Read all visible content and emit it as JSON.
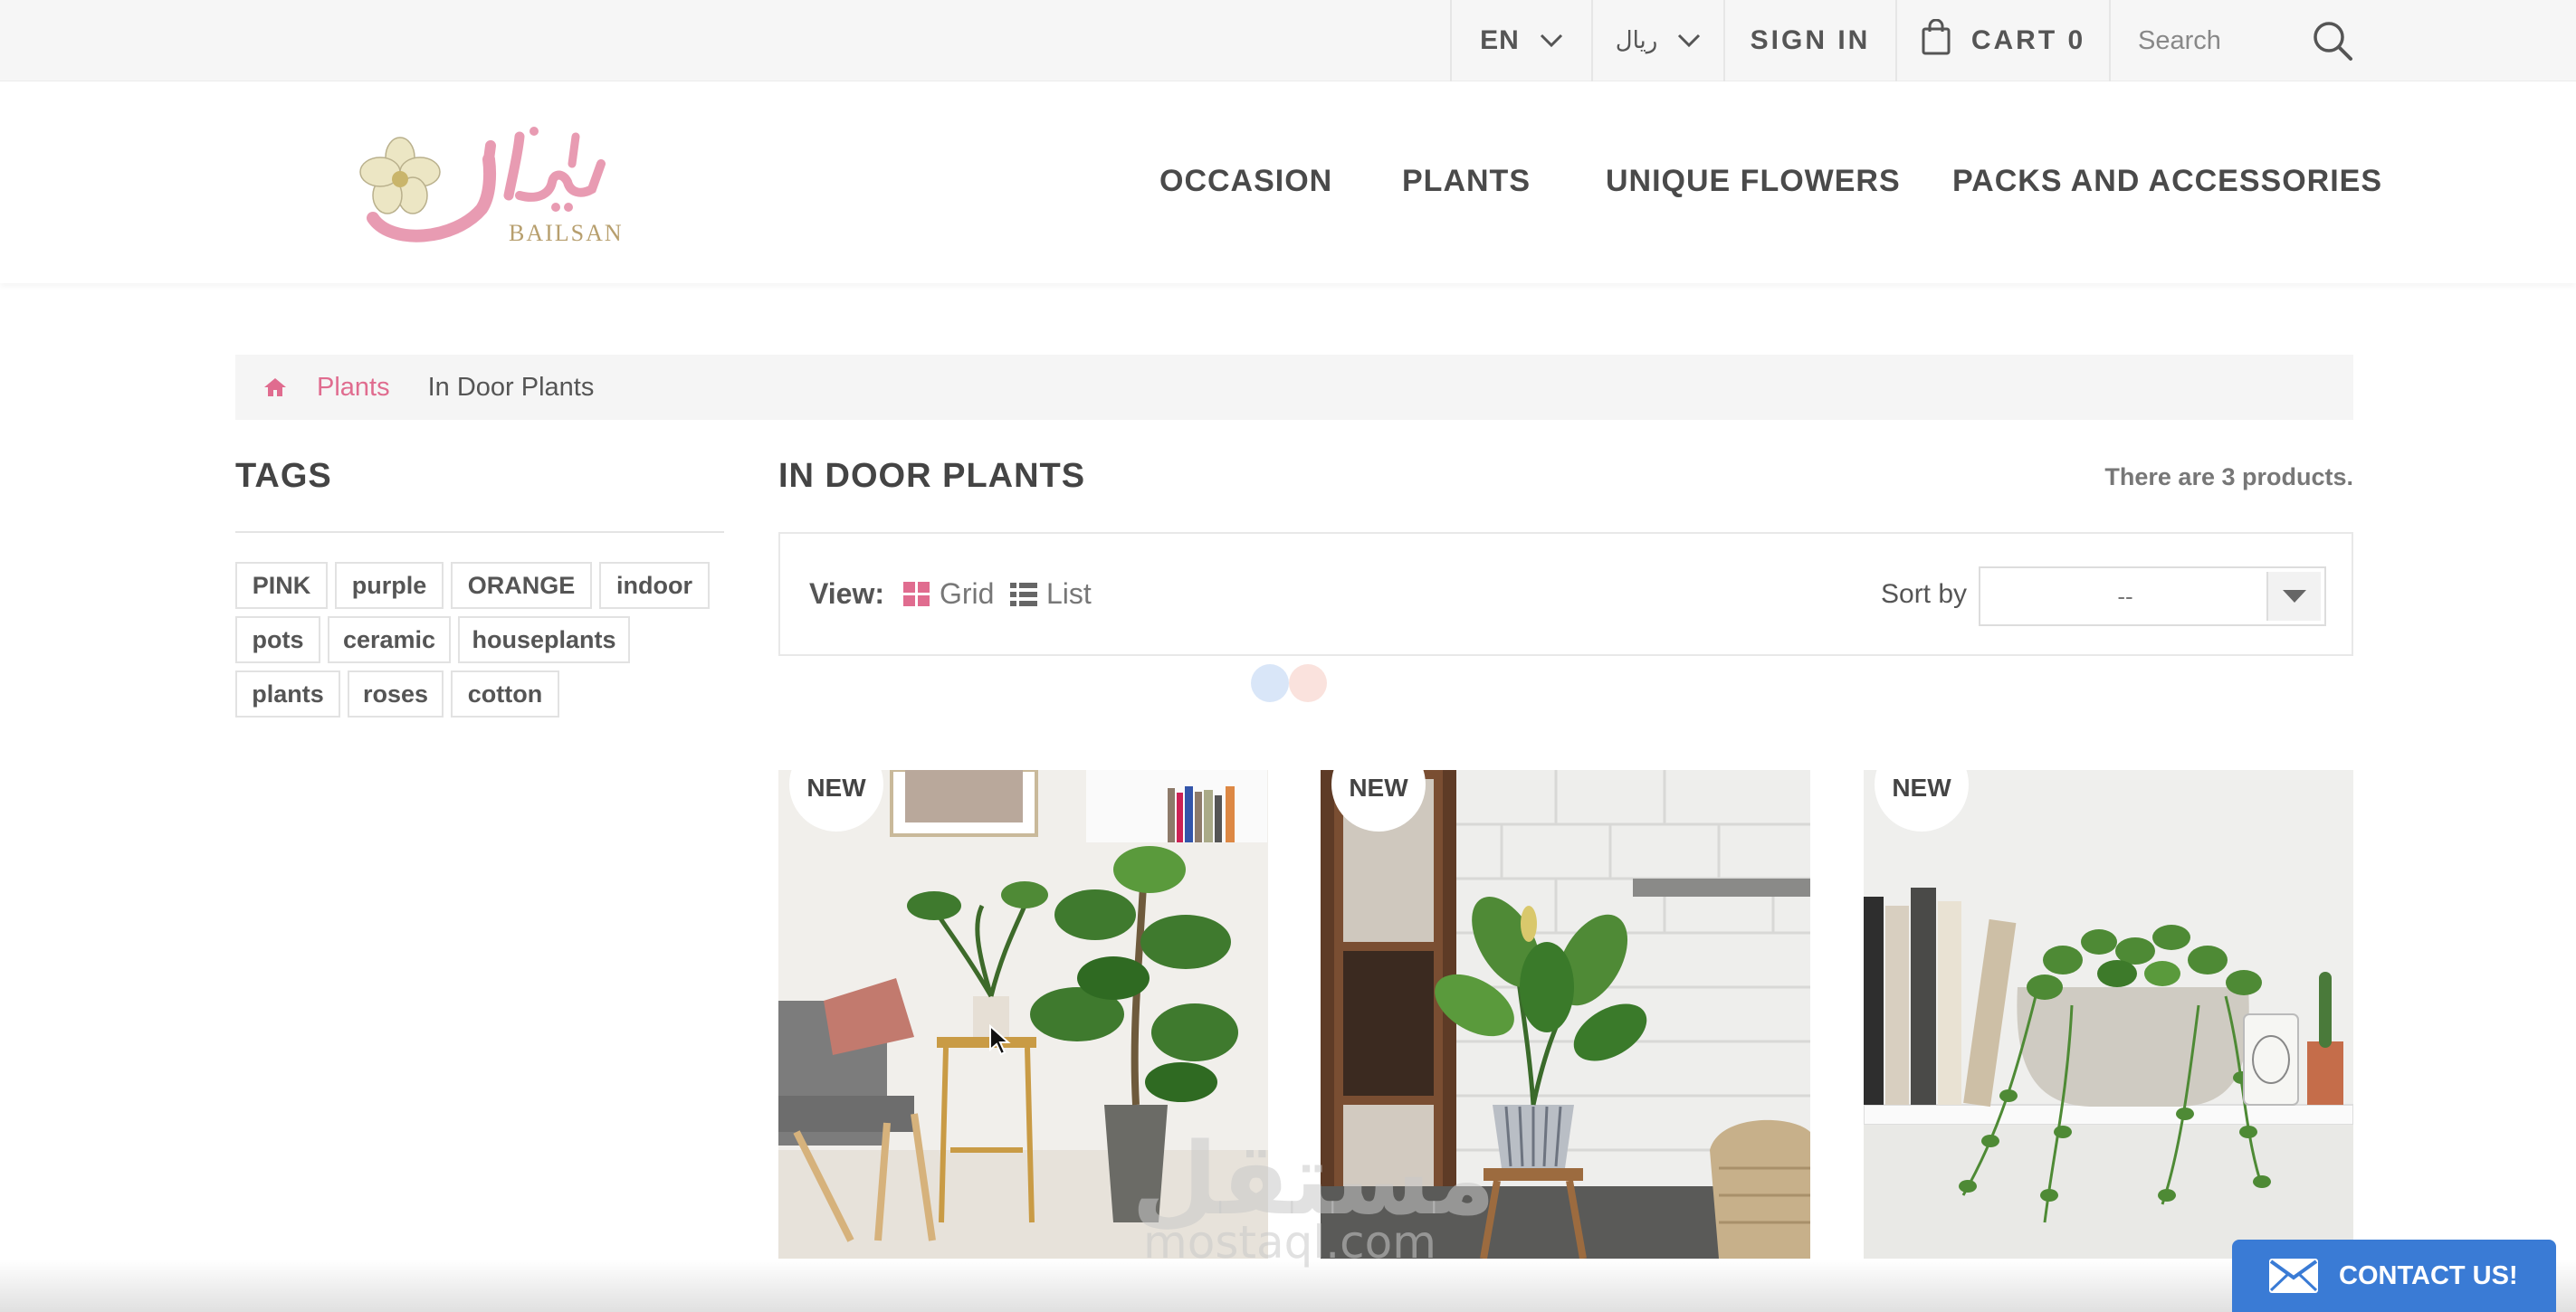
{
  "topbar": {
    "language": "EN",
    "currency": "ریال",
    "sign_in": "SIGN IN",
    "cart_label": "CART 0",
    "search_placeholder": "Search"
  },
  "header": {
    "logo_text": "BAILSAN",
    "nav": [
      "OCCASION",
      "PLANTS",
      "UNIQUE FLOWERS",
      "PACKS AND ACCESSORIES"
    ]
  },
  "breadcrumb": {
    "home_icon": "home-icon",
    "items": [
      "Plants",
      "In Door Plants"
    ]
  },
  "sidebar": {
    "title": "TAGS",
    "tags": [
      "PINK",
      "purple",
      "ORANGE",
      "indoor",
      "pots",
      "ceramic",
      "houseplants",
      "plants",
      "roses",
      "cotton"
    ]
  },
  "category": {
    "title": "IN DOOR PLANTS",
    "product_count": "There are 3 products.",
    "view_label": "View:",
    "view_grid": "Grid",
    "view_list": "List",
    "sort_label": "Sort by",
    "sort_value": "--"
  },
  "products": [
    {
      "badge": "NEW",
      "image": "living-room-plants-photo"
    },
    {
      "badge": "NEW",
      "image": "fiddle-leaf-plant-photo"
    },
    {
      "badge": "NEW",
      "image": "ivy-on-shelf-photo"
    }
  ],
  "watermark": {
    "arabic": "مستقل",
    "latin": "mostaql.com"
  },
  "contact_widget": {
    "label": "CONTACT US!"
  },
  "colors": {
    "accent_pink": "#e06c8f",
    "contact_blue": "#3a7bd5",
    "topbar_bg": "#f6f6f6"
  }
}
